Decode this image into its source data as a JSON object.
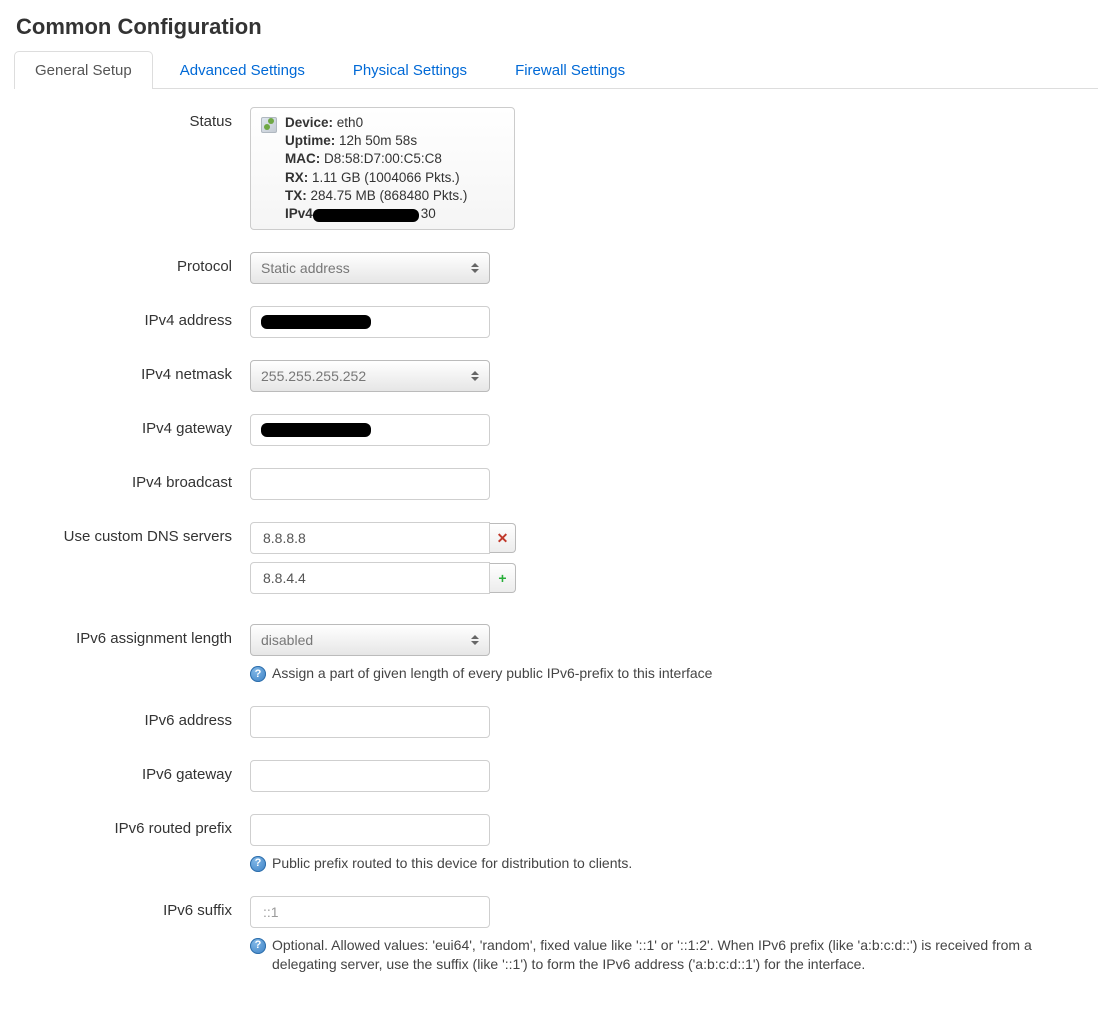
{
  "title": "Common Configuration",
  "tabs": [
    {
      "label": "General Setup",
      "active": true
    },
    {
      "label": "Advanced Settings",
      "active": false
    },
    {
      "label": "Physical Settings",
      "active": false
    },
    {
      "label": "Firewall Settings",
      "active": false
    }
  ],
  "labels": {
    "status": "Status",
    "protocol": "Protocol",
    "ipv4_address": "IPv4 address",
    "ipv4_netmask": "IPv4 netmask",
    "ipv4_gateway": "IPv4 gateway",
    "ipv4_broadcast": "IPv4 broadcast",
    "dns": "Use custom DNS servers",
    "ipv6_assign_len": "IPv6 assignment length",
    "ipv6_address": "IPv6 address",
    "ipv6_gateway": "IPv6 gateway",
    "ipv6_routed_prefix": "IPv6 routed prefix",
    "ipv6_suffix": "IPv6 suffix"
  },
  "status": {
    "device_label": "Device:",
    "device_value": "eth0",
    "uptime_label": "Uptime:",
    "uptime_value": "12h 50m 58s",
    "mac_label": "MAC:",
    "mac_value": "D8:58:D7:00:C5:C8",
    "rx_label": "RX:",
    "rx_value": "1.11 GB (1004066 Pkts.)",
    "tx_label": "TX:",
    "tx_value": "284.75 MB (868480 Pkts.)",
    "ipv4_label": "IPv4",
    "ipv4_tail": "30"
  },
  "protocol_value": "Static address",
  "ipv4_address_value": "",
  "ipv4_netmask_value": "255.255.255.252",
  "ipv4_gateway_value": "",
  "ipv4_broadcast_value": "",
  "dns_servers": [
    "8.8.8.8",
    "8.8.4.4"
  ],
  "ipv6_assign_len_value": "disabled",
  "ipv6_assign_len_help": "Assign a part of given length of every public IPv6-prefix to this interface",
  "ipv6_address_value": "",
  "ipv6_gateway_value": "",
  "ipv6_routed_prefix_value": "",
  "ipv6_routed_prefix_help": "Public prefix routed to this device for distribution to clients.",
  "ipv6_suffix_value": "",
  "ipv6_suffix_placeholder": "::1",
  "ipv6_suffix_help": "Optional. Allowed values: 'eui64', 'random', fixed value like '::1' or '::1:2'. When IPv6 prefix (like 'a:b:c:d::') is received from a delegating server, use the suffix (like '::1') to form the IPv6 address ('a:b:c:d::1') for the interface."
}
